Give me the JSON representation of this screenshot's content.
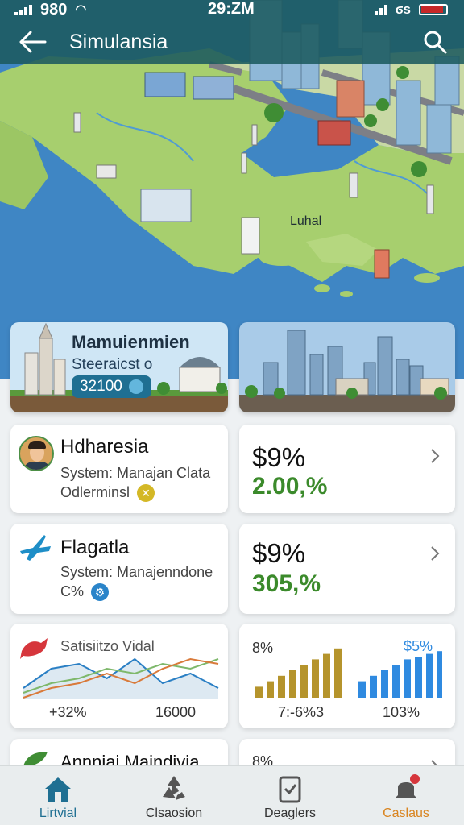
{
  "status_bar": {
    "left_text": "980",
    "time": "29:ZM",
    "right_text": "ϭs"
  },
  "app_bar": {
    "title": "Simulansia"
  },
  "map": {
    "label": "Luhal"
  },
  "hero_cards": [
    {
      "title": "Mamuienmien",
      "subtitle": "Steeraicst o",
      "pill_value": "32100"
    },
    {}
  ],
  "cards": {
    "profile": {
      "name": "Hdharesia",
      "line1": "System: Manajan Clata",
      "line2": "Odlerminsl"
    },
    "stat1": {
      "value": "$9%",
      "change": "2.00,%"
    },
    "flag": {
      "title": "Flagatla",
      "line1": "System: Manajenndone",
      "line2": "C%"
    },
    "stat2": {
      "value": "$9%",
      "change": "305,%"
    },
    "chart1": {
      "title": "Satisiitzo Vidal",
      "left_value": "+32%",
      "right_value": "16000"
    },
    "chart2": {
      "top_left": "8%",
      "top_right": "$5%",
      "left_value": "7:-6%3",
      "right_value": "103%"
    },
    "partial_left": {
      "title": "Annniai Maindivia"
    },
    "partial_right": {
      "value": "8%"
    }
  },
  "chart_data": [
    {
      "type": "line",
      "title": "Satisiitzo Vidal",
      "x": [
        0,
        1,
        2,
        3,
        4,
        5,
        6,
        7
      ],
      "series": [
        {
          "values": [
            2,
            6,
            7,
            4,
            8,
            3,
            5,
            2
          ]
        },
        {
          "values": [
            1,
            3,
            4,
            6,
            5,
            7,
            6,
            8
          ]
        },
        {
          "values": [
            0,
            2,
            3,
            5,
            3,
            6,
            8,
            7
          ]
        }
      ],
      "colors": [
        "#2a7fc4",
        "#7eb86b",
        "#d97a3a"
      ]
    },
    {
      "type": "bar",
      "series": [
        {
          "values": [
            2,
            3,
            4,
            5,
            6,
            7,
            8,
            9
          ]
        },
        {
          "values": [
            3,
            4,
            5,
            6,
            7,
            7.5,
            8,
            8.5
          ]
        }
      ],
      "colors": [
        "#b5942c",
        "#2f8ae0"
      ]
    }
  ],
  "bottom_nav": [
    {
      "label": "Lirtvial"
    },
    {
      "label": "Clsaosion"
    },
    {
      "label": "Deaglers"
    },
    {
      "label": "Caslaus"
    }
  ],
  "colors": {
    "primary": "#1c5a5f",
    "accent": "#1f6f92",
    "positive": "#3b8a2b",
    "ocean": "#3f86c4",
    "land": "#a7cf6e"
  }
}
